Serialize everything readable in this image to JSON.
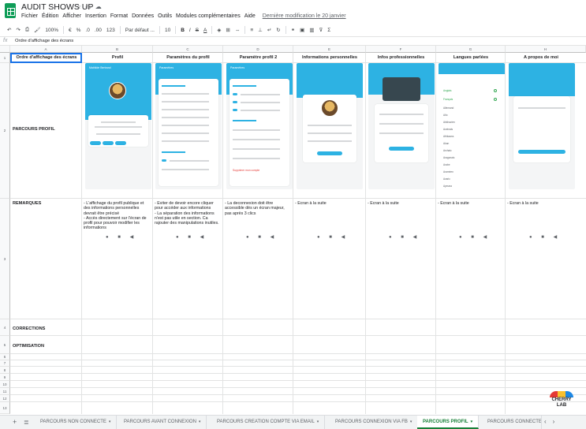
{
  "app": {
    "title": "AUDIT SHOWS UP",
    "menu": [
      "Fichier",
      "Édition",
      "Afficher",
      "Insertion",
      "Format",
      "Données",
      "Outils",
      "Modules complémentaires",
      "Aide"
    ],
    "last_edit": "Dernière modification le 20 janvier"
  },
  "toolbar": {
    "zoom": "100%",
    "currency": "€",
    "percent": "%",
    "dec_less": ".0",
    "dec_more": ".00",
    "format_more": "123",
    "font": "Par défaut ...",
    "font_size": "10",
    "bold": "B",
    "italic": "I",
    "strike": "S",
    "text_color": "A"
  },
  "formula": {
    "fx": "fx",
    "content": "Ordre d'affichage des écrans"
  },
  "columns": [
    "A",
    "B",
    "C",
    "D",
    "E",
    "F",
    "G",
    "H"
  ],
  "rows": [
    "1",
    "2",
    "3",
    "4",
    "5",
    "6",
    "7",
    "8",
    "9",
    "10",
    "11",
    "12",
    "13"
  ],
  "headers": [
    "Ordre d'affichage des écrans",
    "Profil",
    "Paramètres du profil",
    "Paramètre profil 2",
    "Informations personnelles",
    "Infos professionnelles",
    "Langues parlées",
    "A propos de moi"
  ],
  "row_labels": {
    "parcours": "PARCOURS PROFIL",
    "remarques": "REMARQUES",
    "corrections": "CORRECTIONS",
    "optimisation": "OPTIMISATION"
  },
  "remarks": [
    "- L'affichage du profil publique et des informations personnelles devrait être précisé\n- Accès directement sur l'écran de profil pour pouvoir modifier les informations",
    "- Eviter de devoir encore cliquer pour accéder aux informations\n- La séparation des informations n'est pas utile en section. Ca rajouter des manipulations inutiles.",
    "- La deconnexion doit être accessible dès un écran majeur, pas après 3 clics",
    "- Ecran à la suite",
    "- Ecran à la suite",
    "- Ecran à la suite",
    "- Ecran à la suite"
  ],
  "phones": {
    "profil_name": "Mathilde Bertrand",
    "settings_title": "Paramètres",
    "languages": [
      "Anglais",
      "Français",
      "Allemand",
      "Alto",
      "Abkhazien",
      "Aceinais",
      "Afrikaans",
      "Akan",
      "Archaic",
      "Aragonais",
      "Arabe",
      "Araméen",
      "Avaric",
      "Aymara"
    ],
    "logout": "Supprimer mon compte",
    "nav": "● ■ ◀"
  },
  "logo": {
    "text_top": "CHERRY",
    "text_bottom": "LAB"
  },
  "sheets": {
    "tabs": [
      "PARCOURS NON CONNECTE",
      "PARCOURS AVANT CONNEXION",
      "PARCOURS CREATION COMPTE VIA EMAIL",
      "PARCOURS CONNEXION VIA FB",
      "PARCOURS PROFIL",
      "PARCOURS CONNECTE"
    ],
    "active": "PARCOURS PROFIL",
    "arrow": "▾"
  },
  "colors": {
    "accent_green": "#188038",
    "phone_blue": "#2db2e3",
    "selection": "#1a73e8"
  }
}
